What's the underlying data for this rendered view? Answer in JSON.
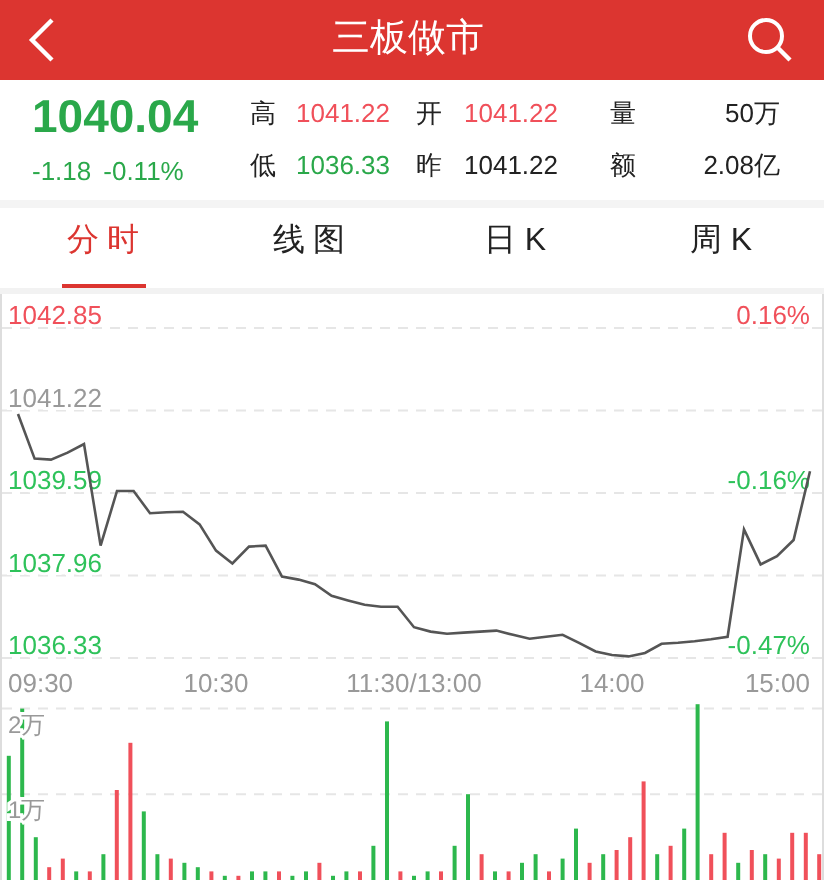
{
  "header": {
    "title": "三板做市"
  },
  "quote": {
    "price": "1040.04",
    "change": "-1.18",
    "change_pct": "-0.11%",
    "color": "#2aa84a",
    "stats": [
      {
        "label": "高",
        "value": "1041.22",
        "color": "#f0505a"
      },
      {
        "label": "开",
        "value": "1041.22",
        "color": "#f0505a"
      },
      {
        "label": "量",
        "value": "50万",
        "color": "#222222"
      },
      {
        "label": "低",
        "value": "1036.33",
        "color": "#2aa84a"
      },
      {
        "label": "昨",
        "value": "1041.22",
        "color": "#222222"
      },
      {
        "label": "额",
        "value": "2.08亿",
        "color": "#222222"
      }
    ]
  },
  "tabs": [
    {
      "label": "分 时",
      "selected": true
    },
    {
      "label": "线 图",
      "selected": false
    },
    {
      "label": "日 K",
      "selected": false
    },
    {
      "label": "周 K",
      "selected": false
    }
  ],
  "price_chart": {
    "tick_rows": [
      {
        "color": "#f0505a",
        "pct": "0.16%"
      },
      {
        "color": "#999999"
      },
      {
        "color": "#2ec25a",
        "pct": "-0.16%"
      },
      {
        "color": "#2ec25a"
      },
      {
        "color": "#2ec25a",
        "pct": "-0.47%"
      }
    ],
    "edge_labels": {
      "start": "09:30",
      "end": "15:00"
    },
    "chart_data": {
      "type": "line",
      "grid": true,
      "ylim": [
        1036.33,
        1042.85
      ],
      "categories": [
        null,
        null,
        null,
        null,
        null,
        null,
        null,
        null,
        null,
        null,
        null,
        null,
        "10:30",
        null,
        null,
        null,
        null,
        null,
        null,
        null,
        null,
        null,
        null,
        null,
        "11:30/13:00",
        null,
        null,
        null,
        null,
        null,
        null,
        null,
        null,
        null,
        null,
        null,
        "14:00",
        null,
        null,
        null,
        null,
        null,
        null,
        null,
        null,
        null,
        null,
        null,
        null
      ],
      "series": [
        {
          "color": "#555555",
          "values": [
            1041.15,
            1040.27,
            1040.25,
            1040.39,
            1040.56,
            1038.55,
            1039.63,
            1039.63,
            1039.19,
            1039.21,
            1039.22,
            1038.97,
            1038.45,
            1038.2,
            1038.53,
            1038.55,
            1037.94,
            1037.88,
            1037.79,
            1037.56,
            1037.47,
            1037.38,
            1037.34,
            1037.34,
            1036.94,
            1036.85,
            1036.81,
            1036.83,
            1036.85,
            1036.87,
            1036.79,
            1036.71,
            1036.75,
            1036.79,
            1036.63,
            1036.46,
            1036.39,
            1036.36,
            1036.43,
            1036.61,
            1036.63,
            1036.66,
            1036.7,
            1036.75,
            1038.87,
            1038.18,
            1038.34,
            1038.66,
            1040.02
          ]
        }
      ],
      "yticks": [
        {
          "value": 1042.85,
          "label": "1042.85"
        },
        {
          "value": 1041.22,
          "label": "1041.22"
        },
        {
          "value": 1039.59,
          "label": "1039.59"
        },
        {
          "value": 1037.96,
          "label": "1037.96"
        },
        {
          "value": 1036.33,
          "label": "1036.33"
        }
      ]
    }
  },
  "volume_chart": {
    "chart_data": {
      "type": "bar",
      "grid": true,
      "stacked": true,
      "ylim": [
        0,
        2.1
      ],
      "yticks": [
        {
          "value": 2,
          "label": "2万"
        },
        {
          "value": 1,
          "label": "1万"
        }
      ],
      "categories": [
        null,
        null,
        null,
        null,
        null,
        null,
        null,
        null,
        null,
        null,
        null,
        null,
        null,
        null,
        null,
        null,
        null,
        null,
        null,
        null,
        null,
        null,
        null,
        null,
        null,
        null,
        null,
        null,
        null,
        null,
        null,
        null,
        null,
        null,
        null,
        null,
        null,
        null,
        null,
        null,
        null,
        null,
        null,
        null,
        null,
        null,
        null,
        null,
        null,
        null,
        null,
        null,
        null,
        null,
        null,
        null,
        null,
        null,
        null,
        null,
        null
      ],
      "series": [
        {
          "color": "#f0505a",
          "values": [
            null,
            null,
            null,
            0.15,
            0.25,
            null,
            0.1,
            null,
            1.05,
            1.6,
            null,
            null,
            0.25,
            null,
            null,
            0.1,
            null,
            0.05,
            null,
            null,
            0.1,
            null,
            null,
            0.2,
            null,
            null,
            0.1,
            null,
            null,
            0.1,
            null,
            null,
            0.1,
            null,
            null,
            0.3,
            null,
            0.1,
            null,
            null,
            0.1,
            null,
            null,
            0.2,
            null,
            0.35,
            0.5,
            1.15,
            null,
            0.4,
            null,
            null,
            0.3,
            0.55,
            null,
            0.35,
            null,
            0.25,
            0.55,
            0.55,
            0.3
          ]
        },
        {
          "color": "#2db84d",
          "values": [
            1.45,
            2.0,
            0.5,
            null,
            null,
            0.1,
            null,
            0.3,
            null,
            null,
            0.8,
            0.3,
            null,
            0.2,
            0.15,
            null,
            0.05,
            null,
            0.1,
            0.1,
            null,
            0.05,
            0.1,
            null,
            0.05,
            0.1,
            null,
            0.4,
            1.85,
            null,
            0.05,
            0.1,
            null,
            0.4,
            1.0,
            null,
            0.1,
            null,
            0.2,
            0.3,
            null,
            0.25,
            0.6,
            null,
            0.3,
            null,
            null,
            null,
            0.3,
            null,
            0.6,
            2.05,
            null,
            null,
            0.2,
            null,
            0.3,
            null,
            null,
            null,
            null
          ]
        }
      ]
    }
  }
}
